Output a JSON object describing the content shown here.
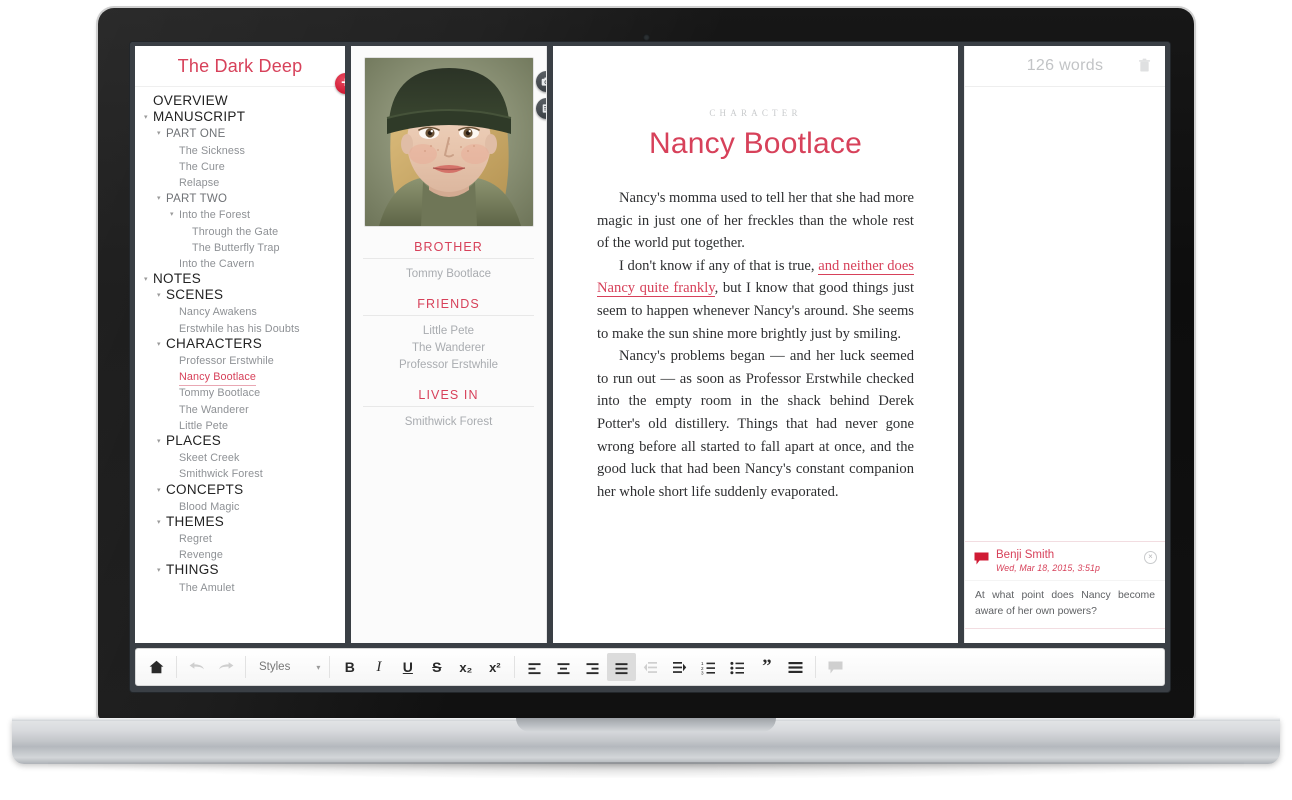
{
  "app": {
    "project_title": "The Dark Deep",
    "add_button_label": "+"
  },
  "sidebar": {
    "items": [
      {
        "label": "OVERVIEW",
        "level": "group",
        "indent": 0,
        "twisty": false,
        "selected": false
      },
      {
        "label": "MANUSCRIPT",
        "level": "group",
        "indent": 0,
        "twisty": true,
        "selected": false
      },
      {
        "label": "PART ONE",
        "level": "sub",
        "indent": 1,
        "twisty": true,
        "selected": false
      },
      {
        "label": "The Sickness",
        "level": "leaf",
        "indent": 2,
        "twisty": false,
        "selected": false
      },
      {
        "label": "The Cure",
        "level": "leaf",
        "indent": 2,
        "twisty": false,
        "selected": false
      },
      {
        "label": "Relapse",
        "level": "leaf",
        "indent": 2,
        "twisty": false,
        "selected": false
      },
      {
        "label": "PART TWO",
        "level": "sub",
        "indent": 1,
        "twisty": true,
        "selected": false
      },
      {
        "label": "Into the Forest",
        "level": "leaf",
        "indent": 2,
        "twisty": true,
        "selected": false
      },
      {
        "label": "Through the Gate",
        "level": "leaf",
        "indent": 3,
        "twisty": false,
        "selected": false
      },
      {
        "label": "The Butterfly Trap",
        "level": "leaf",
        "indent": 3,
        "twisty": false,
        "selected": false
      },
      {
        "label": "Into the Cavern",
        "level": "leaf",
        "indent": 2,
        "twisty": false,
        "selected": false
      },
      {
        "label": "NOTES",
        "level": "group",
        "indent": 0,
        "twisty": true,
        "selected": false
      },
      {
        "label": "SCENES",
        "level": "group",
        "indent": 1,
        "twisty": true,
        "selected": false
      },
      {
        "label": "Nancy Awakens",
        "level": "leaf",
        "indent": 2,
        "twisty": false,
        "selected": false
      },
      {
        "label": "Erstwhile has his Doubts",
        "level": "leaf",
        "indent": 2,
        "twisty": false,
        "selected": false
      },
      {
        "label": "CHARACTERS",
        "level": "group",
        "indent": 1,
        "twisty": true,
        "selected": false
      },
      {
        "label": "Professor Erstwhile",
        "level": "leaf",
        "indent": 2,
        "twisty": false,
        "selected": false
      },
      {
        "label": "Nancy Bootlace",
        "level": "leaf",
        "indent": 2,
        "twisty": false,
        "selected": true
      },
      {
        "label": "Tommy Bootlace",
        "level": "leaf",
        "indent": 2,
        "twisty": false,
        "selected": false
      },
      {
        "label": "The Wanderer",
        "level": "leaf",
        "indent": 2,
        "twisty": false,
        "selected": false
      },
      {
        "label": "Little Pete",
        "level": "leaf",
        "indent": 2,
        "twisty": false,
        "selected": false
      },
      {
        "label": "PLACES",
        "level": "group",
        "indent": 1,
        "twisty": true,
        "selected": false
      },
      {
        "label": "Skeet Creek",
        "level": "leaf",
        "indent": 2,
        "twisty": false,
        "selected": false
      },
      {
        "label": "Smithwick Forest",
        "level": "leaf",
        "indent": 2,
        "twisty": false,
        "selected": false
      },
      {
        "label": "CONCEPTS",
        "level": "group",
        "indent": 1,
        "twisty": true,
        "selected": false
      },
      {
        "label": "Blood Magic",
        "level": "leaf",
        "indent": 2,
        "twisty": false,
        "selected": false
      },
      {
        "label": "THEMES",
        "level": "group",
        "indent": 1,
        "twisty": true,
        "selected": false
      },
      {
        "label": "Regret",
        "level": "leaf",
        "indent": 2,
        "twisty": false,
        "selected": false
      },
      {
        "label": "Revenge",
        "level": "leaf",
        "indent": 2,
        "twisty": false,
        "selected": false
      },
      {
        "label": "THINGS",
        "level": "group",
        "indent": 1,
        "twisty": true,
        "selected": false
      },
      {
        "label": "The Amulet",
        "level": "leaf",
        "indent": 2,
        "twisty": false,
        "selected": false
      }
    ]
  },
  "inspector": {
    "photo_alt": "Portrait of a young girl wearing a dark green knit hat",
    "buttons": [
      {
        "icon": "camera-icon",
        "name": "change-photo-button"
      },
      {
        "icon": "list-icon",
        "name": "metadata-button"
      }
    ],
    "sections": [
      {
        "heading": "BROTHER",
        "items": [
          "Tommy Bootlace"
        ]
      },
      {
        "heading": "FRIENDS",
        "items": [
          "Little Pete",
          "The Wanderer",
          "Professor Erstwhile"
        ]
      },
      {
        "heading": "LIVES IN",
        "items": [
          "Smithwick Forest"
        ]
      }
    ]
  },
  "editor": {
    "kicker": "CHARACTER",
    "title": "Nancy Bootlace",
    "paragraphs": [
      {
        "runs": [
          {
            "text": "Nancy's momma used to tell her that she had more magic in just one of her freckles than the whole rest of the world put together.",
            "style": "normal"
          }
        ]
      },
      {
        "runs": [
          {
            "text": "I don't know if any of that is true, ",
            "style": "normal"
          },
          {
            "text": "and neither does Nancy quite frankly",
            "style": "annotated"
          },
          {
            "text": ", but I know that good things just seem to happen whenever Nancy's around. She seems to make the sun shine more brightly just by smiling.",
            "style": "normal"
          }
        ]
      },
      {
        "runs": [
          {
            "text": "Nancy's problems began — and her luck seemed to run out — as soon as Professor Erstwhile checked into the empty room in the shack behind Derek Potter's old distillery. Things that had never gone wrong before all started to fall apart at once, and the good luck that had been Nancy's constant companion her whole short life suddenly evaporated.",
            "style": "normal"
          }
        ]
      }
    ]
  },
  "comments_panel": {
    "word_count": "126 words",
    "trash_icon": "trash-icon",
    "comments": [
      {
        "author": "Benji Smith",
        "date": "Wed, Mar 18, 2015, 3:51p",
        "text": "At what point does Nancy become aware of her own powers?",
        "close_label": "×"
      }
    ]
  },
  "toolbar": {
    "items": [
      {
        "name": "home-button",
        "icon": "home-icon",
        "glyph": "⌂",
        "state": "enabled"
      },
      {
        "name": "undo-button",
        "icon": "undo-icon",
        "glyph": "↩",
        "state": "disabled"
      },
      {
        "name": "redo-button",
        "icon": "redo-icon",
        "glyph": "↪",
        "state": "disabled"
      },
      {
        "name": "styles-dropdown",
        "icon": "chevron-down-icon",
        "glyph": "▾",
        "state": "enabled",
        "label": "Styles"
      },
      {
        "name": "bold-button",
        "icon": "bold-icon",
        "glyph": "B",
        "state": "enabled"
      },
      {
        "name": "italic-button",
        "icon": "italic-icon",
        "glyph": "I",
        "state": "enabled"
      },
      {
        "name": "underline-button",
        "icon": "underline-icon",
        "glyph": "U",
        "state": "enabled"
      },
      {
        "name": "strikethrough-button",
        "icon": "strikethrough-icon",
        "glyph": "S",
        "state": "enabled"
      },
      {
        "name": "subscript-button",
        "icon": "subscript-icon",
        "glyph": "x₂",
        "state": "enabled"
      },
      {
        "name": "superscript-button",
        "icon": "superscript-icon",
        "glyph": "x²",
        "state": "enabled"
      },
      {
        "name": "align-left-button",
        "icon": "align-left-icon",
        "state": "enabled"
      },
      {
        "name": "align-center-button",
        "icon": "align-center-icon",
        "state": "enabled"
      },
      {
        "name": "align-right-button",
        "icon": "align-right-icon",
        "state": "enabled"
      },
      {
        "name": "align-justify-button",
        "icon": "align-justify-icon",
        "state": "active"
      },
      {
        "name": "outdent-button",
        "icon": "outdent-icon",
        "state": "disabled"
      },
      {
        "name": "indent-button",
        "icon": "indent-icon",
        "state": "enabled"
      },
      {
        "name": "numbered-list-button",
        "icon": "numbered-list-icon",
        "state": "enabled"
      },
      {
        "name": "bullet-list-button",
        "icon": "bullet-list-icon",
        "state": "enabled"
      },
      {
        "name": "blockquote-button",
        "icon": "quote-icon",
        "glyph": "”",
        "state": "enabled"
      },
      {
        "name": "line-spacing-button",
        "icon": "line-spacing-icon",
        "state": "enabled"
      },
      {
        "name": "comment-button",
        "icon": "comment-icon",
        "state": "disabled"
      }
    ],
    "styles_label": "Styles"
  },
  "colors": {
    "accent_red": "#d7415a",
    "add_button_red": "#d01b34",
    "text_dark": "#2f3032",
    "muted": "#a9acb0",
    "bezel": "#111111",
    "screen_frame": "#3a3f45"
  }
}
